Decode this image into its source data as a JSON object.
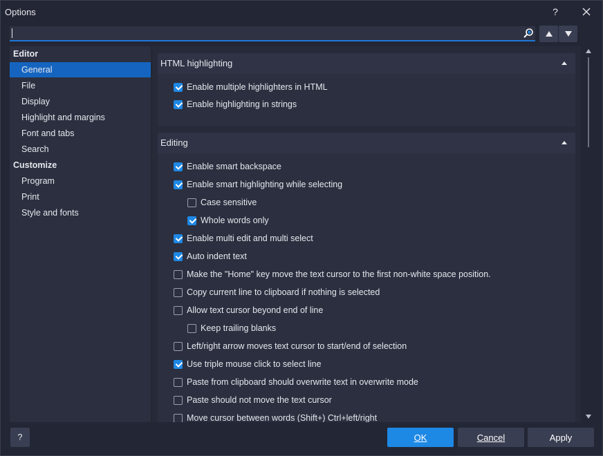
{
  "window": {
    "title": "Options",
    "help_label": "?",
    "close_label": "✕"
  },
  "search": {
    "value": "",
    "placeholder": ""
  },
  "sidebar": {
    "items": [
      {
        "label": "Editor",
        "header": true
      },
      {
        "label": "General",
        "selected": true
      },
      {
        "label": "File"
      },
      {
        "label": "Display"
      },
      {
        "label": "Highlight and margins"
      },
      {
        "label": "Font and tabs"
      },
      {
        "label": "Search"
      },
      {
        "label": "Customize",
        "header": true
      },
      {
        "label": "Program"
      },
      {
        "label": "Print"
      },
      {
        "label": "Style and fonts"
      }
    ]
  },
  "sections": [
    {
      "title": "HTML highlighting",
      "options": [
        {
          "label": "Enable multiple highlighters in HTML",
          "checked": true,
          "indent": 0
        },
        {
          "label": "Enable highlighting in strings",
          "checked": true,
          "indent": 0
        }
      ]
    },
    {
      "title": "Editing",
      "options": [
        {
          "label": "Enable smart backspace",
          "checked": true,
          "indent": 0
        },
        {
          "label": "Enable smart highlighting while selecting",
          "checked": true,
          "indent": 0
        },
        {
          "label": "Case sensitive",
          "checked": false,
          "indent": 1
        },
        {
          "label": "Whole words only",
          "checked": true,
          "indent": 1
        },
        {
          "label": "Enable multi edit and multi select",
          "checked": true,
          "indent": 0
        },
        {
          "label": "Auto indent text",
          "checked": true,
          "indent": 0
        },
        {
          "label": "Make the \"Home\" key move the text cursor to the first non-white space position.",
          "checked": false,
          "indent": 0
        },
        {
          "label": "Copy current line to clipboard if nothing is selected",
          "checked": false,
          "indent": 0
        },
        {
          "label": "Allow text cursor beyond end of line",
          "checked": false,
          "indent": 0
        },
        {
          "label": "Keep trailing blanks",
          "checked": false,
          "indent": 1
        },
        {
          "label": "Left/right arrow moves text cursor to start/end of selection",
          "checked": false,
          "indent": 0
        },
        {
          "label": "Use triple mouse click to select line",
          "checked": true,
          "indent": 0
        },
        {
          "label": "Paste from clipboard should overwrite text in overwrite mode",
          "checked": false,
          "indent": 0
        },
        {
          "label": "Paste should not move the text cursor",
          "checked": false,
          "indent": 0
        },
        {
          "label": "Move cursor between words (Shift+) Ctrl+left/right",
          "checked": false,
          "indent": 0
        }
      ]
    }
  ],
  "footer": {
    "help_label": "?",
    "ok_label": "OK",
    "cancel_label": "Cancel",
    "apply_label": "Apply"
  },
  "colors": {
    "accent": "#1e88e5",
    "selected": "#1565c0",
    "background": "#232634"
  }
}
